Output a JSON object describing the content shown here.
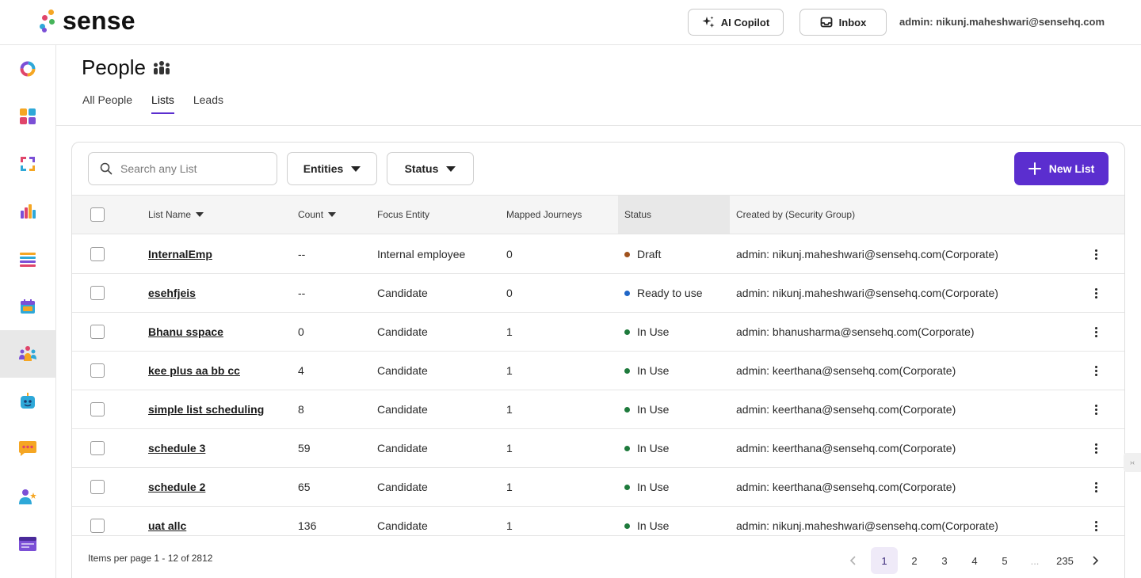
{
  "brand": {
    "name": "sense",
    "dot_colors": [
      "#f5a623",
      "#e0456a",
      "#2ea8d8",
      "#46b45a",
      "#7b4fd6"
    ]
  },
  "topbar": {
    "copilot_label": "AI Copilot",
    "inbox_label": "Inbox",
    "user": "admin: nikunj.maheshwari@sensehq.com"
  },
  "sidebar": {
    "items": [
      {
        "icon": "ring-icon"
      },
      {
        "icon": "dashboard-grid-icon"
      },
      {
        "icon": "workflow-arrows-icon"
      },
      {
        "icon": "bar-chart-icon"
      },
      {
        "icon": "list-stack-icon"
      },
      {
        "icon": "calendar-icon"
      },
      {
        "icon": "people-icon",
        "active": true
      },
      {
        "icon": "bot-icon"
      },
      {
        "icon": "chat-icon"
      },
      {
        "icon": "user-star-icon"
      },
      {
        "icon": "window-icon"
      }
    ]
  },
  "page": {
    "title": "People",
    "tabs": [
      {
        "label": "All People"
      },
      {
        "label": "Lists",
        "active": true
      },
      {
        "label": "Leads"
      }
    ]
  },
  "toolbar": {
    "search_placeholder": "Search any List",
    "entities_label": "Entities",
    "status_label": "Status",
    "new_list_label": "New List"
  },
  "table": {
    "columns": {
      "name": "List Name",
      "count": "Count",
      "focus": "Focus Entity",
      "journeys": "Mapped Journeys",
      "status": "Status",
      "created": "Created by (Security Group)"
    },
    "status_colors": {
      "Draft": "#a0521d",
      "Ready to use": "#1f66c7",
      "In Use": "#1e7a3c"
    },
    "rows": [
      {
        "name": "InternalEmp",
        "count": "--",
        "focus": "Internal employee",
        "journeys": "0",
        "status": "Draft",
        "created": "admin: nikunj.maheshwari@sensehq.com(Corporate)"
      },
      {
        "name": "esehfjeis",
        "count": "--",
        "focus": "Candidate",
        "journeys": "0",
        "status": "Ready to use",
        "created": "admin: nikunj.maheshwari@sensehq.com(Corporate)"
      },
      {
        "name": "Bhanu sspace",
        "count": "0",
        "focus": "Candidate",
        "journeys": "1",
        "status": "In Use",
        "created": "admin: bhanusharma@sensehq.com(Corporate)"
      },
      {
        "name": "kee plus aa bb cc",
        "count": "4",
        "focus": "Candidate",
        "journeys": "1",
        "status": "In Use",
        "created": "admin: keerthana@sensehq.com(Corporate)"
      },
      {
        "name": "simple list scheduling",
        "count": "8",
        "focus": "Candidate",
        "journeys": "1",
        "status": "In Use",
        "created": "admin: keerthana@sensehq.com(Corporate)"
      },
      {
        "name": "schedule 3",
        "count": "59",
        "focus": "Candidate",
        "journeys": "1",
        "status": "In Use",
        "created": "admin: keerthana@sensehq.com(Corporate)"
      },
      {
        "name": "schedule 2",
        "count": "65",
        "focus": "Candidate",
        "journeys": "1",
        "status": "In Use",
        "created": "admin: keerthana@sensehq.com(Corporate)"
      },
      {
        "name": "uat allc",
        "count": "136",
        "focus": "Candidate",
        "journeys": "1",
        "status": "In Use",
        "created": "admin: nikunj.maheshwari@sensehq.com(Corporate)"
      }
    ]
  },
  "pagination": {
    "items_label": "Items per page 1 - 12 of 2812",
    "pages": [
      "1",
      "2",
      "3",
      "4",
      "5",
      "...",
      "235"
    ],
    "current": "1"
  },
  "edge_tab_text": "›‹"
}
